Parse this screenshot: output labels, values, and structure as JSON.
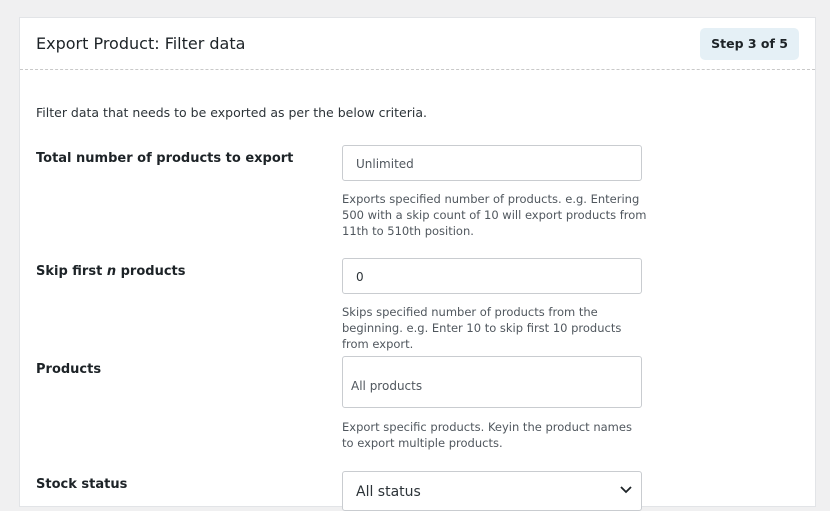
{
  "header": {
    "title": "Export Product: Filter data",
    "step": "Step 3 of 5"
  },
  "intro": "Filter data that needs to be exported as per the below criteria.",
  "rows": [
    {
      "label": "Total number of products to export",
      "placeholder": "Unlimited",
      "help": "Exports specified number of products. e.g. Entering 500 with a skip count of 10 will export products from 11th to 510th position."
    },
    {
      "label_before": "Skip first ",
      "label_em": "n",
      "label_after": " products",
      "value": "0",
      "help": "Skips specified number of products from the beginning. e.g. Enter 10 to skip first 10 products from export."
    },
    {
      "label": "Products",
      "placeholder": "All products",
      "help": "Export specific products. Keyin the product names to export multiple products."
    },
    {
      "label": "Stock status",
      "selected": "All status"
    }
  ]
}
